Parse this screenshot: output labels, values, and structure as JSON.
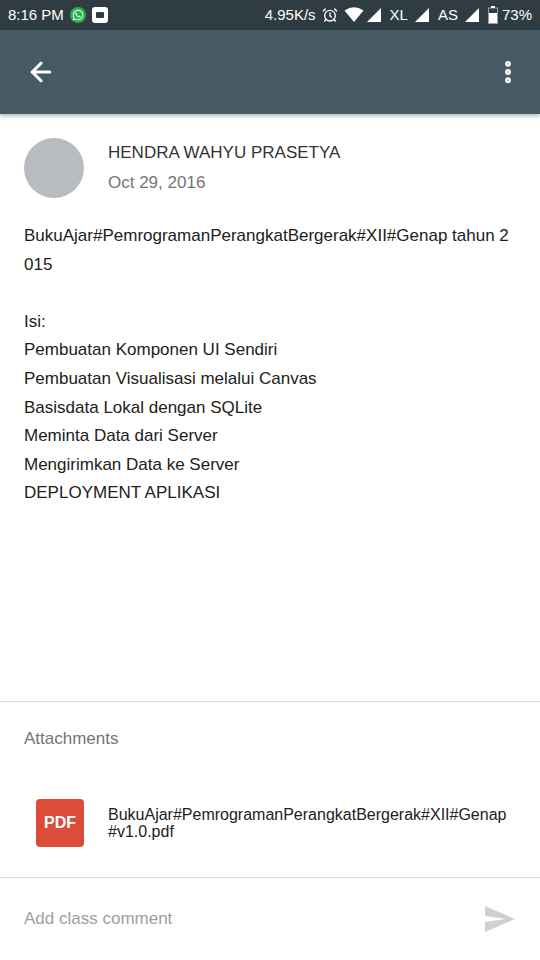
{
  "status_bar": {
    "time": "8:16 PM",
    "network_speed": "4.95K/s",
    "carriers": [
      {
        "name": "XL"
      },
      {
        "name": "AS"
      }
    ],
    "battery": "73%",
    "battery_level": 0.73
  },
  "post": {
    "author": "HENDRA WAHYU PRASETYA",
    "date": "Oct 29, 2016",
    "title": "BukuAjar#PemrogramanPerangkatBergerak#XII#Genap tahun 2015",
    "contents_label": "Isi:",
    "contents": [
      "Pembuatan Komponen UI Sendiri",
      "Pembuatan Visualisasi melalui Canvas",
      "Basisdata Lokal dengan SQLite",
      "Meminta Data dari Server",
      "Mengirimkan Data ke Server",
      "DEPLOYMENT APLIKASI"
    ]
  },
  "attachments": {
    "label": "Attachments",
    "files": [
      {
        "name": "BukuAjar#PemrogramanPerangkatBergerak#XII#Genap#v1.0.pdf",
        "type": "PDF"
      }
    ]
  },
  "comment": {
    "placeholder": "Add class comment"
  }
}
